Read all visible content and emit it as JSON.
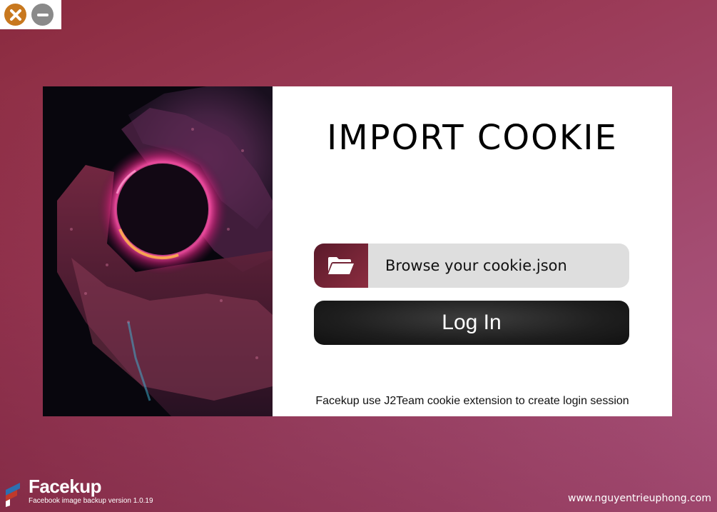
{
  "window": {
    "close_icon": "close-icon",
    "minimize_icon": "minimize-icon",
    "close_color": "#c8781e",
    "minimize_color": "#8a8a8a"
  },
  "card": {
    "title": "IMPORT COOKIE",
    "browse": {
      "icon": "folder-open-icon",
      "label": "Browse your cookie.json"
    },
    "login_label": "Log In",
    "footnote": "Facekup use J2Team cookie extension to create login session"
  },
  "brand": {
    "name": "Facekup",
    "subtitle": "Facebook image backup version 1.0.19"
  },
  "website": "www.nguyentrieuphong.com",
  "colors": {
    "accent": "#8c2d40",
    "background": "#9b3b58",
    "button_dark": "#1e1e1e",
    "input_bg": "#dedede"
  }
}
